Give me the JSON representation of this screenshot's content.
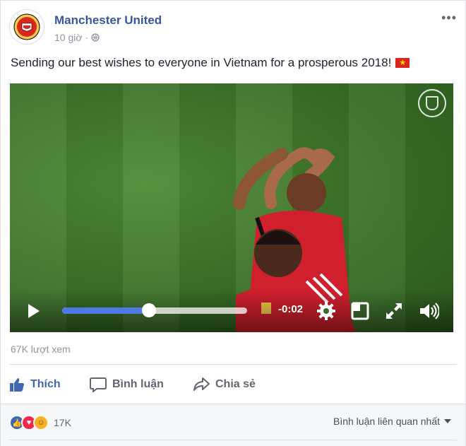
{
  "post": {
    "page_name": "Manchester United",
    "time": "10 giờ",
    "separator": "·",
    "text": "Sending our best wishes to everyone in Vietnam for a prosperous 2018!",
    "flag_icon": "vietnam-flag-icon",
    "more_label": "•••"
  },
  "video": {
    "progress": 0.47,
    "remaining_time": "-0:02",
    "icons": [
      "play-icon",
      "settings-gear-icon",
      "expand-icon",
      "fullscreen-icon",
      "volume-icon"
    ]
  },
  "stats": {
    "views": "67K lượt xem"
  },
  "actions": {
    "like": "Thích",
    "comment": "Bình luận",
    "share": "Chia sẻ"
  },
  "footer": {
    "reaction_count": "17K",
    "sort_label": "Bình luận liên quan nhất"
  },
  "colors": {
    "link": "#365899",
    "like": "#4267b2",
    "progress": "#4f7ae3",
    "mu_red": "#da291c"
  }
}
